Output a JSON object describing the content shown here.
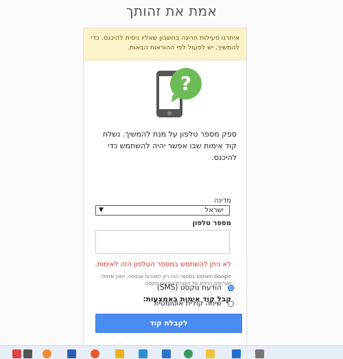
{
  "page": {
    "title": "אמת את זהותך"
  },
  "warning": {
    "text": "איתרנו פעילות חריגה בחשבון שאליו ניסית להיכנס. כדי להמשיך, יש לפעול לפי ההוראות הבאות."
  },
  "instructions": "ספק מספר טלפון על מנת להמשיך. נשלח קוד אימות שבו אפשר יהיה להשתמש כדי להיכנס.",
  "country": {
    "label": "מדינה",
    "value": "ישראל"
  },
  "phone": {
    "label": "מספר טלפון",
    "value": ""
  },
  "error": "לא ניתן להשתמש במספר הטלפון הזה לאימות.",
  "note": "Google תשתמש במספר הזה רק למטרות אבטחה. ייתכן שיחולו תעריפים רגילים של העברת הודעות טקסט.",
  "method": {
    "heading": "קבל קוד אימות באמצעות:",
    "options": [
      {
        "label": "הודעת טקסט (SMS)",
        "selected": true
      },
      {
        "label": "שיחה קולית אוטומטית",
        "selected": false
      }
    ]
  },
  "submit_label": "לקבלת קוד",
  "icons": {
    "illustration": "phone-question-icon"
  },
  "colors": {
    "accent": "#4a8cf2",
    "error": "#d93025",
    "warning_bg": "#fbf3c8",
    "illustration_green": "#6dbb57"
  }
}
